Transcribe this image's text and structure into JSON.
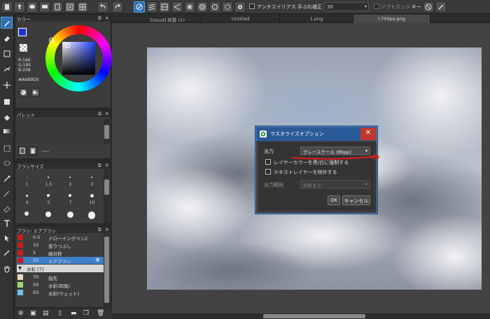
{
  "toolbar": {
    "antialias_label": "アンチエイリアス",
    "stabilizer_label": "手ぶれ補正",
    "stabilizer_value": "30",
    "soft_edge_label": "ソフトエッジ",
    "key_label": "キー"
  },
  "tools": [
    {
      "icon": "brush-icon"
    },
    {
      "icon": "eraser-icon"
    },
    {
      "icon": "lasso-icon"
    },
    {
      "icon": "magic-wand-icon"
    },
    {
      "icon": "move-icon"
    },
    {
      "icon": "select-rect-icon"
    },
    {
      "icon": "fill-bucket-icon"
    },
    {
      "icon": "gradient-icon"
    },
    {
      "icon": "select-dotted-icon"
    },
    {
      "icon": "lasso-select-icon"
    },
    {
      "icon": "wand-select-icon"
    },
    {
      "icon": "select-pen-icon"
    },
    {
      "icon": "select-eraser-icon"
    },
    {
      "icon": "text-icon"
    },
    {
      "icon": "operation-icon"
    },
    {
      "icon": "eyedropper-icon"
    },
    {
      "icon": "hand-icon"
    }
  ],
  "color_panel": {
    "title": "カラー",
    "r_label": "R:166",
    "g_label": "G:185",
    "b_label": "B:208",
    "hex_label": "#A6B9D0"
  },
  "palette_panel": {
    "title": "パレット",
    "placeholder": "----"
  },
  "brush_size_panel": {
    "title": "ブラシサイズ",
    "sizes": [
      "1",
      "1.5",
      "2",
      "3",
      "4",
      "5",
      "7",
      "10"
    ]
  },
  "brush_panel": {
    "title": "ブラシ: エアブラシ",
    "rows": [
      {
        "size": "0.5",
        "name": "ドローイングペン2",
        "color": "#c81e1e"
      },
      {
        "size": "10",
        "name": "塗りつぶし",
        "color": "#c81e1e"
      },
      {
        "size": "5",
        "name": "線対称",
        "color": "#c81e1e"
      },
      {
        "size": "50",
        "name": "エアブラシ",
        "color": "#c81e1e",
        "selected": true
      }
    ],
    "group_label": "水彩 [7]",
    "group_rows": [
      {
        "size": "70",
        "name": "指先",
        "color": "#f0d8c0"
      },
      {
        "size": "56",
        "name": "水彩(四角)",
        "color": "#a0d870"
      },
      {
        "size": "63",
        "name": "水彩(ウェット)",
        "color": "#70c0e8"
      }
    ]
  },
  "tabs": [
    {
      "label": "[cloud] 背景 r1*"
    },
    {
      "label": "Untitled"
    },
    {
      "label": "1.png"
    },
    {
      "label": "l-700px.png",
      "active": true
    }
  ],
  "dialog": {
    "title": "ラスタライズオプション",
    "output_label": "出力",
    "output_value": "グレースケール (8bpp)",
    "check1": "レイヤーカラーを黒/白に強制する",
    "check2": "テキストレイヤーを除外する",
    "range_label": "出力範囲",
    "range_value": "外枠まで",
    "ok_label": "OK",
    "cancel_label": "キャンセル"
  },
  "colors": {
    "accent": "#2f6fb0",
    "dialog_title": "#2a5a98",
    "close": "#c0392b",
    "annotation": "#d0201c"
  }
}
